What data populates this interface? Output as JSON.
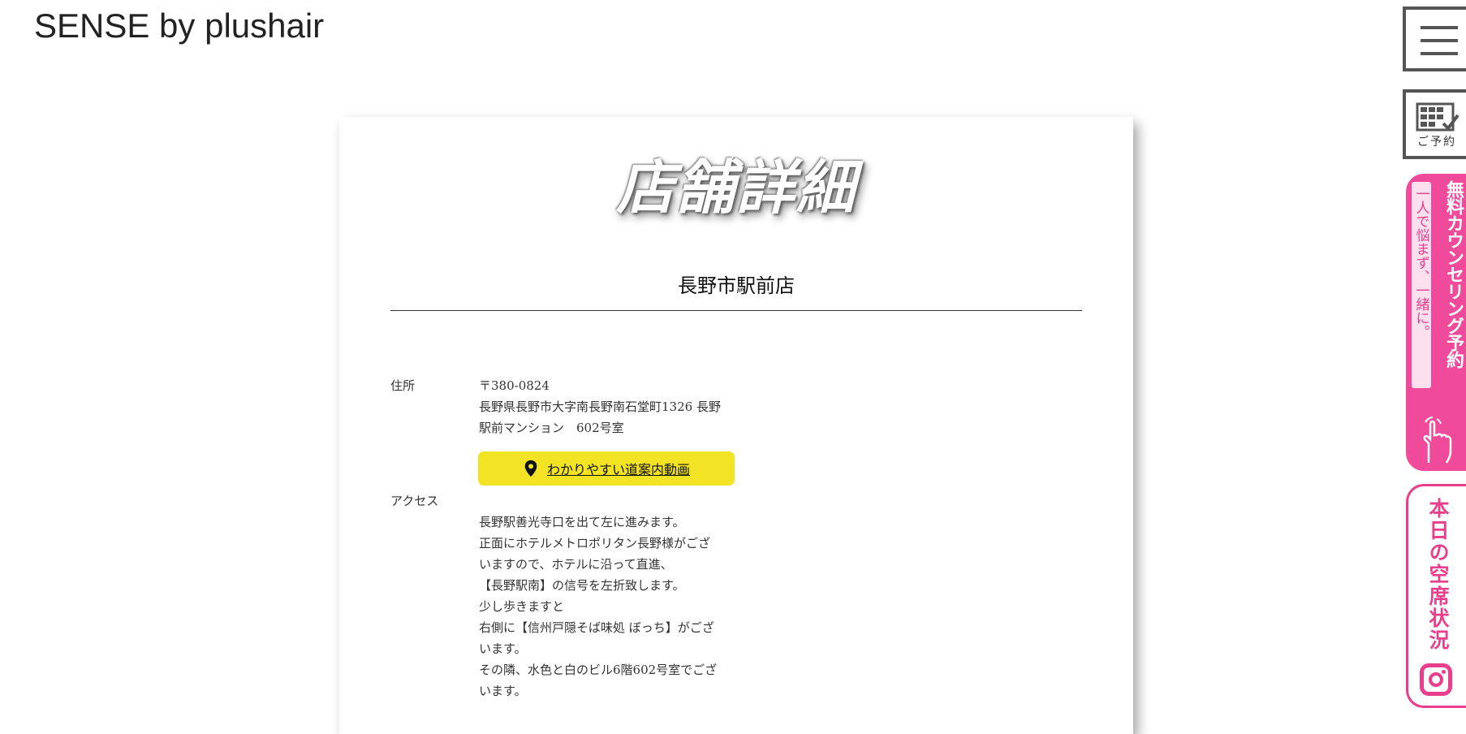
{
  "brand": {
    "logo_text": "SENSE by plushair"
  },
  "page": {
    "title": "店舗詳細"
  },
  "store": {
    "name": "長野市駅前店",
    "address_label": "住所",
    "postal": "〒380-0824",
    "address_line1": "長野県長野市大字南長野南石堂町1326 長野",
    "address_line2": "駅前マンション　602号室",
    "map_button_label": "わかりやすい道案内動画",
    "access_label": "アクセス",
    "access_lines": [
      "長野駅善光寺口を出て左に進みます。",
      "正面にホテルメトロポリタン長野様がござ",
      "いますので、ホテルに沿って直進、",
      "【長野駅南】の信号を左折致します。",
      "少し歩きますと",
      "右側に【信州戸隠そば味処 ぼっち】がござ",
      "います。",
      "その隣、水色と白のビル6階602号室でござ",
      "います。"
    ]
  },
  "sidebar": {
    "reserve_label": "ご予約",
    "counseling_main": "無料カウンセリング予約",
    "counseling_sub": "一人で悩まず、一緒に。",
    "today_label": "本日の空席状況"
  },
  "colors": {
    "accent_pink": "#e83e8c",
    "map_button": "#f2e424"
  }
}
